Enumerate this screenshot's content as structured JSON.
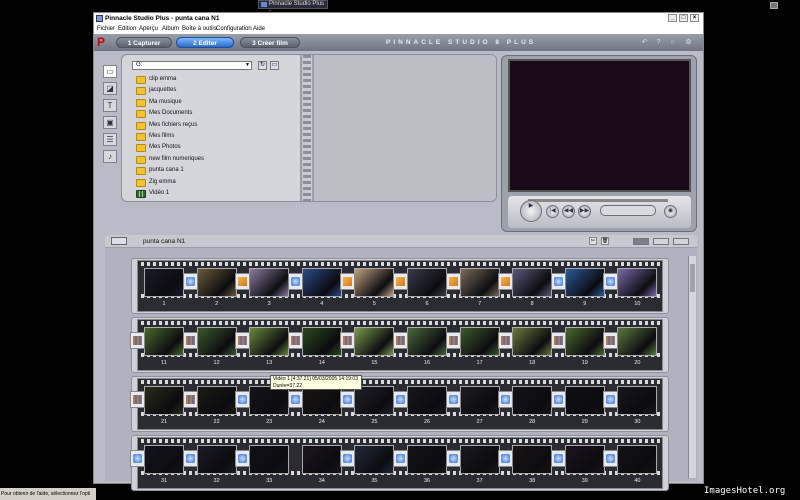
{
  "taskbar": {
    "active_task": "Pinnacle Studio Plus - "
  },
  "window": {
    "title": "Pinnacle Studio Plus - punta cana N1",
    "menu": [
      "Fichier",
      "Edition",
      "Aperçu",
      "Album",
      "Boîte à outils",
      "Configuration",
      "Aide"
    ]
  },
  "modes": {
    "tabs": [
      {
        "label": "1 Capturer",
        "active": false
      },
      {
        "label": "2 Editer",
        "active": true
      },
      {
        "label": "3 Créer film",
        "active": false
      }
    ],
    "brand": "PINNACLE STUDIO 8 PLUS"
  },
  "album": {
    "current_folder": "G:",
    "items": [
      {
        "label": "clip emma",
        "type": "folder"
      },
      {
        "label": "jacquettes",
        "type": "folder"
      },
      {
        "label": "Ma musique",
        "type": "folder"
      },
      {
        "label": "Mes Documents",
        "type": "folder"
      },
      {
        "label": "Mes fichiers reçus",
        "type": "folder"
      },
      {
        "label": "Mes films",
        "type": "folder"
      },
      {
        "label": "Mes Photos",
        "type": "folder"
      },
      {
        "label": "new film numeriques",
        "type": "folder"
      },
      {
        "label": "punta cana 1",
        "type": "folder"
      },
      {
        "label": "Zig emma",
        "type": "folder"
      },
      {
        "label": "Vidéo 1",
        "type": "video"
      }
    ]
  },
  "storyboard": {
    "title": "punta cana N1",
    "rows": [
      {
        "numbers": [
          "1",
          "2",
          "3",
          "4",
          "5",
          "6",
          "7",
          "8",
          "9",
          "10"
        ]
      },
      {
        "numbers": [
          "11",
          "12",
          "13",
          "14",
          "15",
          "16",
          "17",
          "18",
          "19",
          "20"
        ]
      },
      {
        "numbers": [
          "21",
          "22",
          "23",
          "24",
          "25",
          "26",
          "27",
          "28",
          "29",
          "30"
        ]
      },
      {
        "numbers": [
          "31",
          "32",
          "33",
          "34",
          "35",
          "36",
          "37",
          "38",
          "39",
          "40"
        ]
      }
    ]
  },
  "tooltip": {
    "line1": "Vidéo 1 [4:37.21]  05/03/2005 14:19:03",
    "line2": "Durée=37.22"
  },
  "status_bar": "Pour obtenir de l'aide, sélectionnez l'opti",
  "watermark": "ImagesHotel.org"
}
